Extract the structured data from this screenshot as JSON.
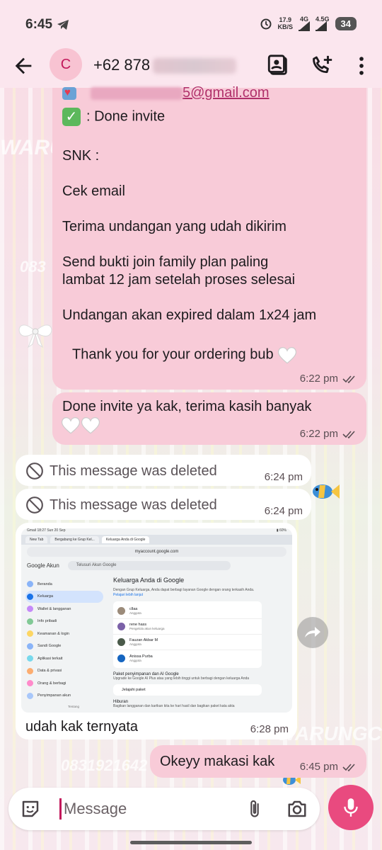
{
  "status_bar": {
    "time": "6:45",
    "speed_top": "17.9",
    "speed_unit": "KB/S",
    "net1": "4G",
    "net2": "4.5G",
    "battery": "34"
  },
  "header": {
    "avatar_letter": "C",
    "contact_number": "+62 878"
  },
  "messages": {
    "invite": {
      "email": "5@gmail.com",
      "done": ": Done invite",
      "snk": "SNK :",
      "line1": "Cek email",
      "line2": "Terima undangan yang udah dikirim",
      "line3a": "Send bukti join family plan paling",
      "line3b": "lambat 12 jam setelah proses selesai",
      "line4": "Undangan akan expired dalam 1x24 jam",
      "line5": "Thank you for your ordering bub",
      "time": "6:22 pm"
    },
    "done": {
      "text": "Done invite ya kak, terima kasih banyak",
      "time": "6:22 pm"
    },
    "deleted1": {
      "text": "This message was deleted",
      "time": "6:24 pm"
    },
    "deleted2": {
      "text": "This message was deleted",
      "time": "6:24 pm"
    },
    "image_msg": {
      "caption": "udah kak ternyata",
      "time": "6:28 pm"
    },
    "okey": {
      "text": "Okeyy makasi kak",
      "time": "6:45 pm"
    }
  },
  "screenshot": {
    "status": "Gmail  18:27  Sun 20 Sep",
    "battery": "▮ 60%",
    "tabs": [
      "New Tab",
      "Bergabung ke Grup Kel...",
      "Keluarga Anda di Google"
    ],
    "url": "myaccount.google.com",
    "logo": "Google Akun",
    "search": "Telusuri Akun Google",
    "sidebar": [
      "Beranda",
      "Keluarga",
      "Wallet & langganan",
      "Info pribadi",
      "Keamanan & login",
      "Sandi Google",
      "Aplikasi terkait",
      "Data & privasi",
      "Orang & berbagi",
      "Penyimpanan akun"
    ],
    "footer": "Tentang",
    "title": "Keluarga Anda di Google",
    "desc": "Dengan Grup Keluarga, Anda dapat berbagi layanan Google dengan orang terkasih Anda.",
    "learn": "Pelajari lebih lanjut",
    "members": [
      {
        "name": "cllaa",
        "role": "Anggota"
      },
      {
        "name": "rene hass",
        "role": "Pengelola akun keluarga"
      },
      {
        "name": "Fauzan Akbar M",
        "role": "Anggota"
      },
      {
        "name": "Anissa Purba",
        "role": "Anggota"
      }
    ],
    "storage_title": "Paket penyimpanan dan AI Google",
    "storage_desc": "Upgrade ke Google AI Plus atau yang lebih tinggi untuk berbagi dengan keluarga Anda",
    "explore": "Jelajahi paket",
    "entertainment": "Hiburan",
    "entertainment_desc": "Bagikan langganan dan kartkan kita ke hari hasil dan bagikan paket kata akta"
  },
  "input": {
    "placeholder": "Message"
  },
  "wallpaper": {
    "wm1": "WARU",
    "wm2": "083",
    "wm3": "WARUNGCE",
    "wm4": "0831921642"
  }
}
